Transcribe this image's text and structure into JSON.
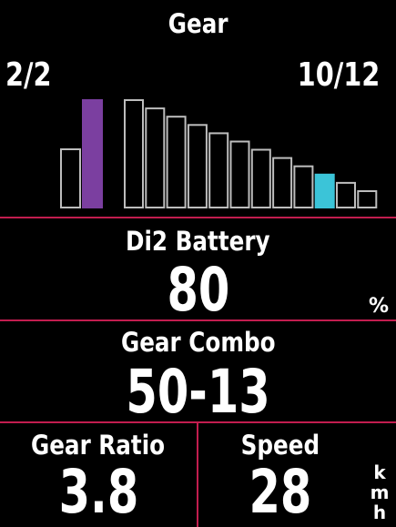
{
  "gear": {
    "title": "Gear",
    "front": "2/2",
    "rear": "10/12",
    "front_chainrings": 2,
    "front_active": 2,
    "rear_cogs": 12,
    "rear_active": 10,
    "colors": {
      "front_active": "#7b3fa0",
      "rear_active": "#3bc4d8",
      "outline": "#bdbdbd"
    }
  },
  "battery": {
    "title": "Di2 Battery",
    "value": "80",
    "unit": "%"
  },
  "combo": {
    "title": "Gear Combo",
    "value": "50-13"
  },
  "ratio": {
    "title": "Gear Ratio",
    "value": "3.8"
  },
  "speed": {
    "title": "Speed",
    "value": "28",
    "unit": [
      "k",
      "m",
      "h"
    ]
  },
  "colors": {
    "divider": "#c21d4f",
    "background": "#000000",
    "text": "#ffffff"
  }
}
